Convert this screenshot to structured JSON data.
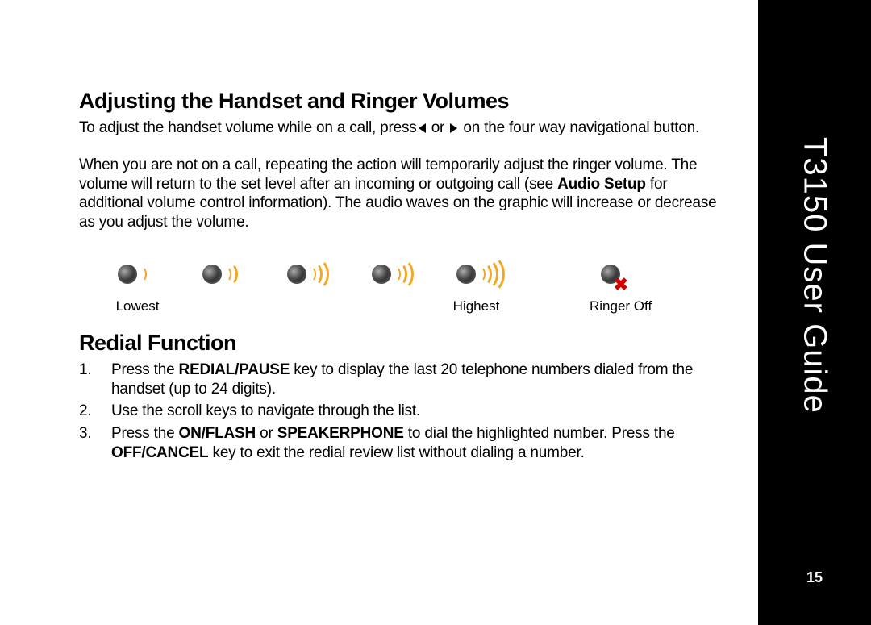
{
  "sidebar": {
    "title": "T3150 User Guide",
    "page_number": "15"
  },
  "section1": {
    "heading": "Adjusting the Handset and Ringer Volumes",
    "para1_a": "To adjust the handset volume while on a call, press",
    "para1_b": " or ",
    "para1_c": " on the four way navigational button.",
    "para2_a": "When you are not on a call, repeating the action will temporarily adjust the ringer volume. The volume will return to the set level after an incoming or outgoing call (see ",
    "para2_bold": "Audio Setup",
    "para2_b": " for additional volume control information). The audio waves on the graphic will increase or decrease as you adjust the volume."
  },
  "volume_labels": {
    "lowest": "Lowest",
    "highest": "Highest",
    "ringer_off": "Ringer Off"
  },
  "section2": {
    "heading": "Redial Function",
    "item1_a": "Press the ",
    "item1_bold": "REDIAL/PAUSE",
    "item1_b": " key to display the last 20 telephone numbers dialed from the handset (up to 24 digits).",
    "item2": "Use the scroll keys to navigate through the list.",
    "item3_a": "Press the ",
    "item3_bold1": "ON/FLASH",
    "item3_b": " or ",
    "item3_bold2": "SPEAKERPHONE",
    "item3_c": " to dial the highlighted number. Press the ",
    "item3_bold3": "OFF/CANCEL",
    "item3_d": " key to exit the redial review list without dialing a number."
  }
}
